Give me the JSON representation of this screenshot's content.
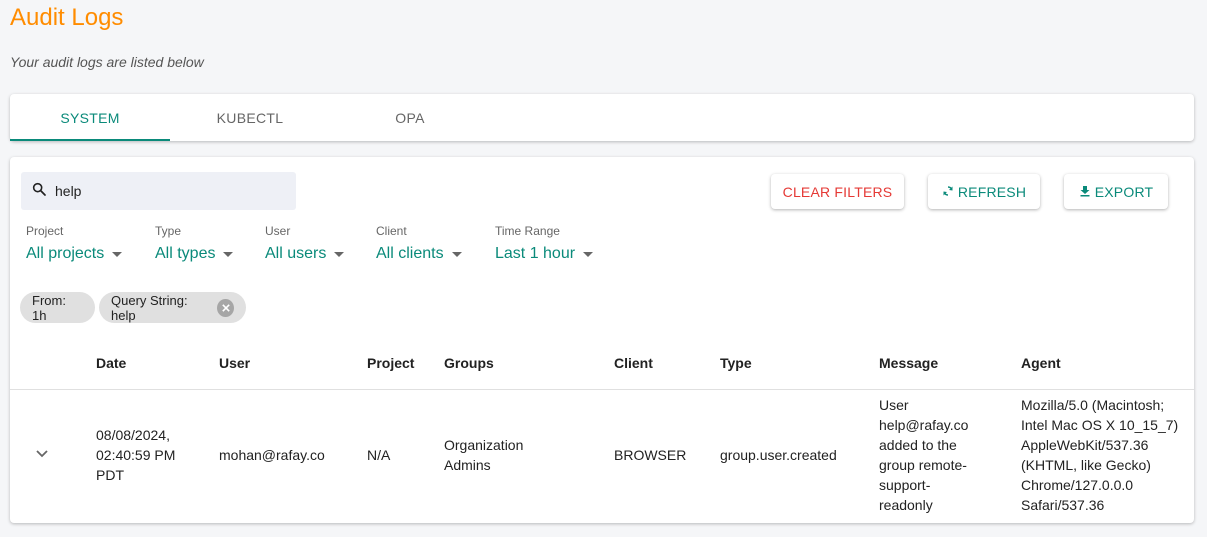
{
  "page": {
    "title": "Audit Logs",
    "subtitle": "Your audit logs are listed below"
  },
  "tabs": [
    {
      "label": "SYSTEM",
      "active": true
    },
    {
      "label": "KUBECTL",
      "active": false
    },
    {
      "label": "OPA",
      "active": false
    }
  ],
  "search": {
    "value": "help",
    "icon": "search-icon"
  },
  "buttons": {
    "clear_filters": "CLEAR FILTERS",
    "refresh": "REFRESH",
    "export": "EXPORT"
  },
  "filters": [
    {
      "label": "Project",
      "value": "All projects"
    },
    {
      "label": "Type",
      "value": "All types"
    },
    {
      "label": "User",
      "value": "All users"
    },
    {
      "label": "Client",
      "value": "All clients"
    },
    {
      "label": "Time Range",
      "value": "Last 1 hour"
    }
  ],
  "chips": [
    {
      "label": "From: 1h",
      "removable": false
    },
    {
      "label": "Query String: help",
      "removable": true
    }
  ],
  "table": {
    "columns": [
      "Date",
      "User",
      "Project",
      "Groups",
      "Client",
      "Type",
      "Message",
      "Agent"
    ],
    "rows": [
      {
        "date": [
          "08/08/2024,",
          "02:40:59 PM",
          "PDT"
        ],
        "user": "mohan@rafay.co",
        "project": "N/A",
        "groups": [
          "Organization",
          "Admins"
        ],
        "client": "BROWSER",
        "type": "group.user.created",
        "message": [
          "User",
          "help@rafay.co",
          "added to the",
          "group remote-",
          "support-",
          "readonly"
        ],
        "agent": [
          "Mozilla/5.0 (Macintosh;",
          "Intel Mac OS X 10_15_7)",
          "AppleWebKit/537.36",
          "(KHTML, like Gecko)",
          "Chrome/127.0.0.0",
          "Safari/537.36"
        ]
      }
    ]
  },
  "colors": {
    "title": "#ff8c00",
    "accent": "#0a8a7a",
    "danger": "#e53935",
    "background": "#f5f6f8"
  }
}
